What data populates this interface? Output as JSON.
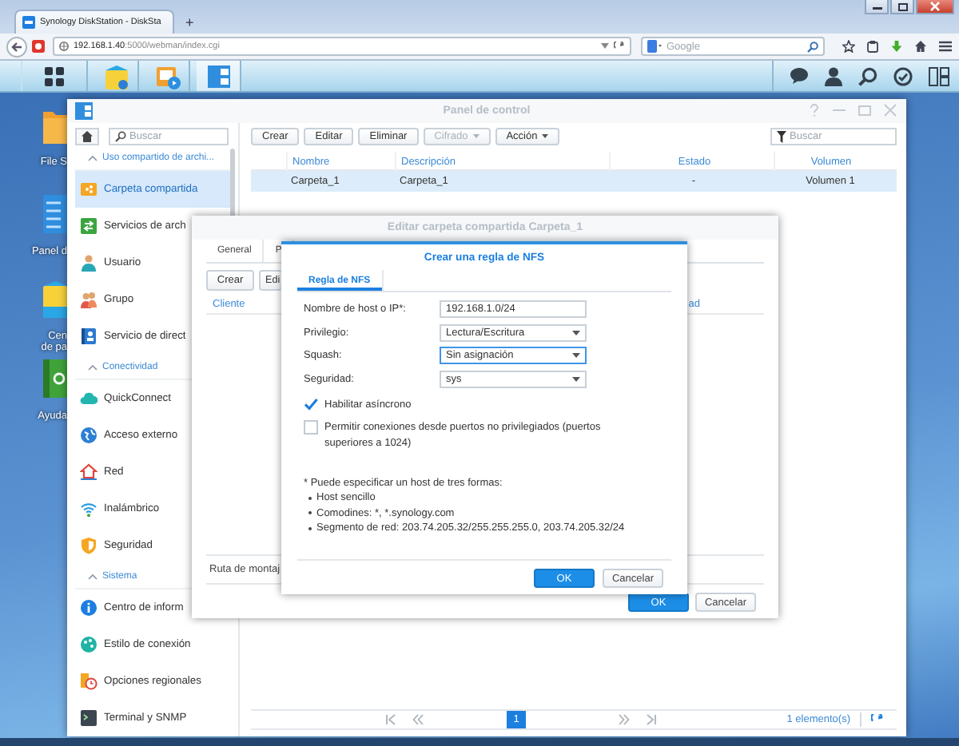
{
  "browser": {
    "tabs": [
      {
        "title": "Synology DiskStation - DiskSta",
        "selected": true
      }
    ],
    "new_tab": "+",
    "url": "**192.168.1.40**:5000/webman/index.cgi",
    "search": {
      "placeholder": "Google"
    }
  },
  "taskbar": {
    "apps": [
      {
        "kind": "bag",
        "selected": false
      },
      {
        "kind": "media",
        "selected": false
      },
      {
        "kind": "panel",
        "selected": true
      }
    ]
  },
  "desktop": {
    "icons": [
      {
        "label": "File S",
        "kind": "folder"
      },
      {
        "label": "Panel d",
        "kind": "panel"
      },
      {
        "label": "Cen\nde pa",
        "kind": "bag"
      },
      {
        "label": "Ayuda",
        "kind": "help"
      }
    ]
  },
  "control_panel": {
    "title": "Panel de control",
    "search": {
      "placeholder": "Buscar"
    },
    "sidebar": [
      {
        "title": "Uso compartido de archi...",
        "expanded": true,
        "items": [
          {
            "label": "Carpeta compartida",
            "kind": "share",
            "selected": true
          },
          {
            "label": "Servicios de arch",
            "kind": "services",
            "selected": false
          },
          {
            "label": "Usuario",
            "kind": "user",
            "selected": false
          },
          {
            "label": "Grupo",
            "kind": "group",
            "selected": false
          },
          {
            "label": "Servicio de direct",
            "kind": "directory",
            "selected": false
          }
        ]
      },
      {
        "title": "Conectividad",
        "expanded": true,
        "items": [
          {
            "label": "QuickConnect",
            "kind": "quickconnect",
            "selected": false
          },
          {
            "label": "Acceso externo",
            "kind": "external",
            "selected": false
          },
          {
            "label": "Red",
            "kind": "network",
            "selected": false
          },
          {
            "label": "Inalámbrico",
            "kind": "wireless",
            "selected": false
          },
          {
            "label": "Seguridad",
            "kind": "security",
            "selected": false
          }
        ]
      },
      {
        "title": "Sistema",
        "expanded": true,
        "items": [
          {
            "label": "Centro de inform",
            "kind": "info",
            "selected": false
          },
          {
            "label": "Estilo de conexión",
            "kind": "theme",
            "selected": false
          },
          {
            "label": "Opciones regionales",
            "kind": "regional",
            "selected": false
          },
          {
            "label": "Terminal y SNMP",
            "kind": "terminal",
            "selected": false
          }
        ]
      }
    ],
    "toolbar": [
      {
        "label": "Crear",
        "disabled": false,
        "dropdown": false
      },
      {
        "label": "Editar",
        "disabled": false,
        "dropdown": false
      },
      {
        "label": "Eliminar",
        "disabled": false,
        "dropdown": false
      },
      {
        "label": "Cifrado",
        "disabled": true,
        "dropdown": true
      },
      {
        "label": "Acción",
        "disabled": false,
        "dropdown": true
      }
    ],
    "filter": {
      "placeholder": "Buscar"
    },
    "table": {
      "columns": [
        "Nombre",
        "Descripción",
        "Estado",
        "Volumen"
      ],
      "rows": [
        {
          "cells": [
            "Carpeta_1",
            "Carpeta_1",
            "-",
            "Volumen 1"
          ],
          "selected": true
        }
      ]
    },
    "pager": {
      "pages": [
        {
          "label": "1",
          "selected": true
        }
      ],
      "count": "1 elemento(s)"
    }
  },
  "edit_dialog": {
    "title": "Editar carpeta compartida Carpeta_1",
    "tabs": [
      {
        "label": "General",
        "selected": false
      },
      {
        "label": "P",
        "selected": false
      }
    ],
    "buttons": [
      "Crear",
      "Edi"
    ],
    "columns": [
      "Cliente",
      "ad"
    ],
    "mount_label": "Ruta de montaj",
    "actions": [
      {
        "label": "OK",
        "primary": true
      },
      {
        "label": "Cancelar",
        "primary": false
      }
    ]
  },
  "nfs_dialog": {
    "title": "Crear una regla de NFS",
    "tabs": [
      {
        "label": "Regla de NFS",
        "selected": true
      }
    ],
    "fields": [
      {
        "label": "Nombre de host o IP*:",
        "value": "192.168.1.0/24",
        "kind": "text",
        "focused": false
      },
      {
        "label": "Privilegio:",
        "value": "Lectura/Escritura",
        "kind": "select",
        "focused": false
      },
      {
        "label": "Squash:",
        "value": "Sin asignación",
        "kind": "select",
        "focused": true
      },
      {
        "label": "Seguridad:",
        "value": "sys",
        "kind": "select",
        "focused": false
      }
    ],
    "checkboxes": [
      {
        "label": "Habilitar asíncrono",
        "checked": true
      },
      {
        "label": "Permitir conexiones desde puertos no privilegiados (puertos superiores a 1024)",
        "checked": false
      }
    ],
    "note": {
      "title": "* Puede especificar un host de tres formas:",
      "bullets": [
        "Host sencillo",
        "Comodines: *, *.synology.com",
        "Segmento de red: 203.74.205.32/255.255.255.0, 203.74.205.32/24"
      ]
    },
    "actions": [
      {
        "label": "OK",
        "primary": true
      },
      {
        "label": "Cancelar",
        "primary": false
      }
    ]
  }
}
